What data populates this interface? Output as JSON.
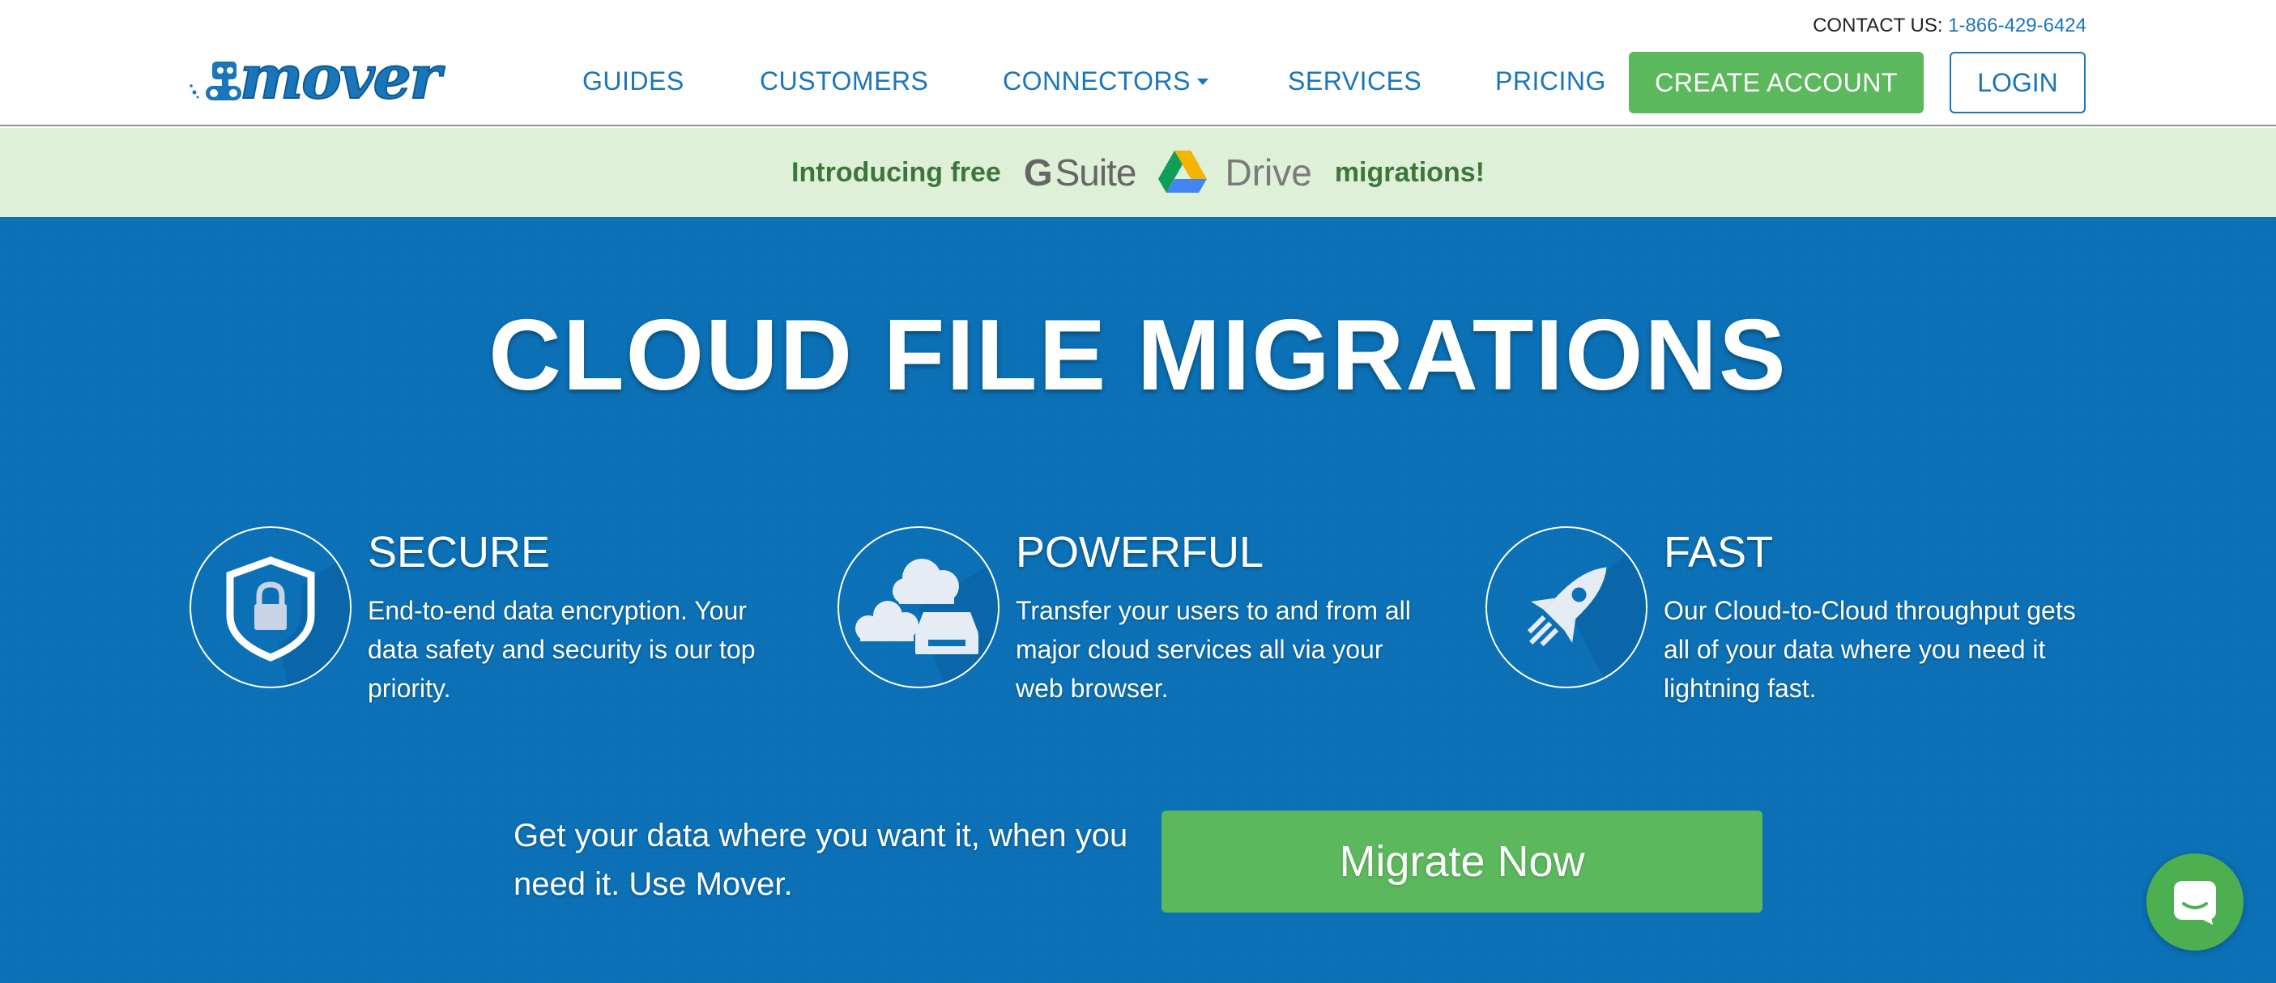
{
  "header": {
    "contact_label": "CONTACT US:",
    "contact_phone": "1-866-429-6424",
    "logo_text": "mover",
    "nav": [
      {
        "label": "GUIDES"
      },
      {
        "label": "CUSTOMERS"
      },
      {
        "label": "CONNECTORS"
      },
      {
        "label": "SERVICES"
      },
      {
        "label": "PRICING"
      }
    ],
    "create_account": "CREATE ACCOUNT",
    "login": "LOGIN"
  },
  "promo": {
    "intro": "Introducing free",
    "gsuite_g": "G",
    "gsuite_suite": "Suite",
    "drive": "Drive",
    "outro": "migrations!"
  },
  "hero": {
    "title": "CLOUD FILE MIGRATIONS",
    "features": [
      {
        "title": "SECURE",
        "desc": "End-to-end data encryption. Your data safety and security is our top priority.",
        "icon": "shield-lock-icon"
      },
      {
        "title": "POWERFUL",
        "desc": "Transfer your users to and from all major cloud services all via your web browser.",
        "icon": "cloud-drive-icon"
      },
      {
        "title": "FAST",
        "desc": "Our Cloud-to-Cloud throughput gets all of your data where you need it lightning fast.",
        "icon": "rocket-icon"
      }
    ],
    "tagline": "Get your data where you want it, when you need it. Use Mover.",
    "cta": "Migrate Now"
  },
  "colors": {
    "brand_blue": "#1a75bb",
    "hero_blue": "#0b70b5",
    "green": "#5cb85c",
    "promo_bg": "#dff0d8"
  }
}
